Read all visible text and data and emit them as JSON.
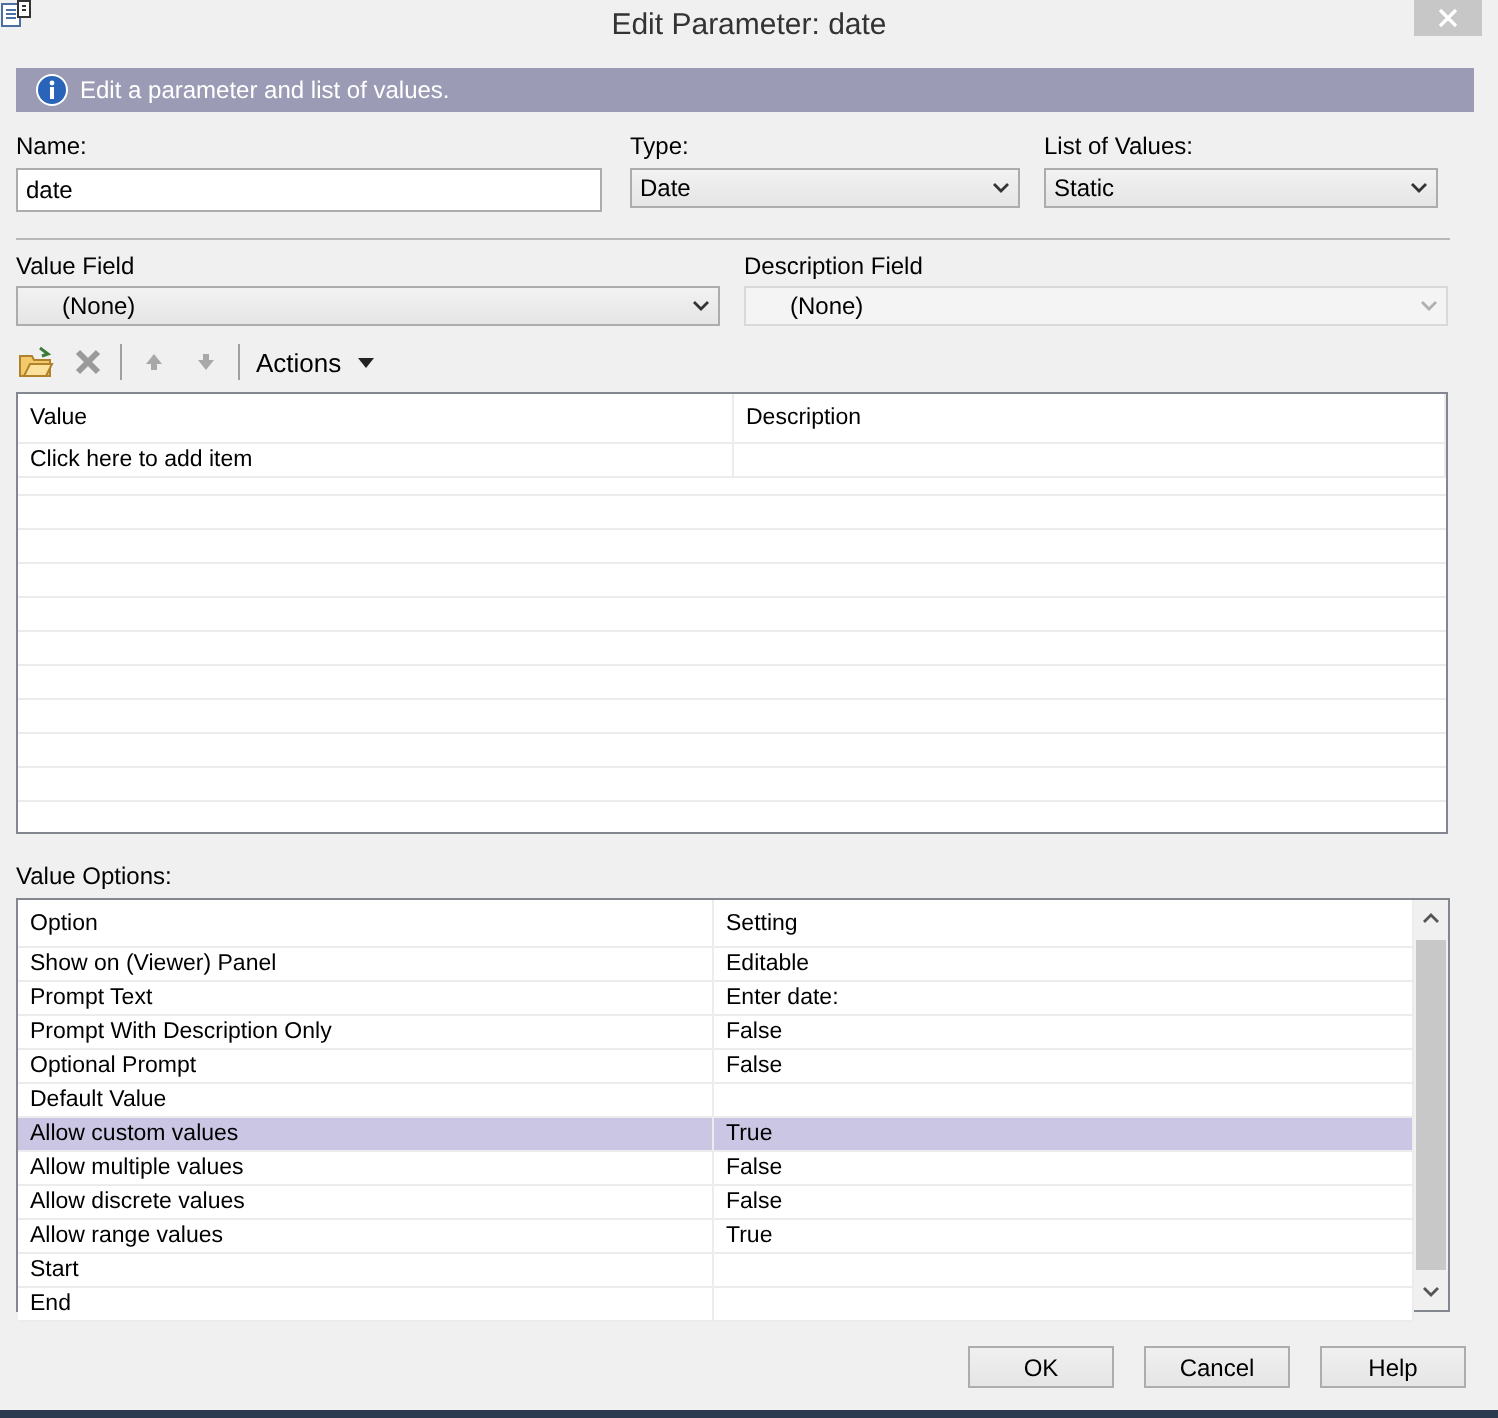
{
  "window": {
    "title": "Edit Parameter: date"
  },
  "banner": {
    "text": "Edit a parameter and list of values."
  },
  "name": {
    "label": "Name:",
    "value": "date"
  },
  "type": {
    "label": "Type:",
    "value": "Date"
  },
  "list_of_values": {
    "label": "List of Values:",
    "value": "Static"
  },
  "value_field": {
    "label": "Value Field",
    "value": "(None)",
    "disabled": false
  },
  "description_field": {
    "label": "Description Field",
    "value": "(None)",
    "disabled": true
  },
  "toolbar": {
    "items": [
      {
        "kind": "add",
        "disabled": false
      },
      {
        "kind": "delete",
        "disabled": true
      },
      {
        "kind": "separator"
      },
      {
        "kind": "up",
        "disabled": true
      },
      {
        "kind": "down",
        "disabled": true
      },
      {
        "kind": "separator"
      },
      {
        "kind": "menu",
        "label": "Actions"
      }
    ]
  },
  "values_table": {
    "columns": [
      "Value",
      "Description"
    ],
    "rows": [
      {
        "value": "Click here to add item"
      }
    ]
  },
  "value_options": {
    "label": "Value Options:",
    "columns": [
      "Option",
      "Setting"
    ],
    "rows": [
      {
        "option": "Show on (Viewer) Panel",
        "setting": "Editable",
        "selected": false
      },
      {
        "option": "Prompt Text",
        "setting": "Enter date:",
        "selected": false
      },
      {
        "option": "Prompt With Description Only",
        "setting": "False",
        "selected": false
      },
      {
        "option": "Optional Prompt",
        "setting": "False",
        "selected": false
      },
      {
        "option": "Default Value",
        "selected": false
      },
      {
        "option": "Allow custom values",
        "setting": "True",
        "selected": true
      },
      {
        "option": "Allow multiple values",
        "setting": "False",
        "selected": false
      },
      {
        "option": "Allow discrete values",
        "setting": "False",
        "selected": false
      },
      {
        "option": "Allow range values",
        "setting": "True",
        "selected": false
      },
      {
        "option": "Start",
        "selected": false
      },
      {
        "option": "End",
        "selected": false
      }
    ]
  },
  "buttons": [
    "OK",
    "Cancel",
    "Help"
  ]
}
